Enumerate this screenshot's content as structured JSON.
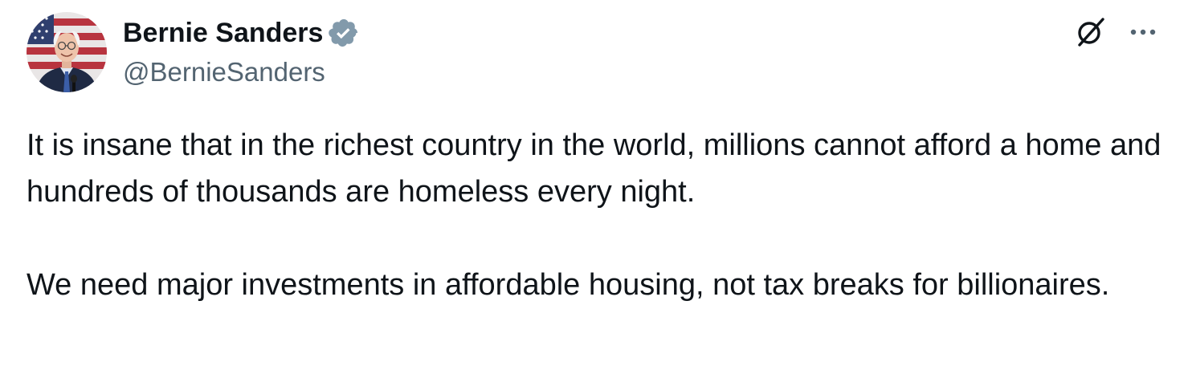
{
  "author": {
    "display_name": "Bernie Sanders",
    "handle": "@BernieSanders",
    "verified": true,
    "avatar_icon": "bernie-sanders-avatar",
    "badge_color": "#829aab"
  },
  "actions": {
    "grok_icon": "grok-icon",
    "more_icon": "more-options-icon"
  },
  "tweet": {
    "paragraphs": [
      "It is insane that in the richest country in the world, millions cannot afford a home and hundreds of thousands are homeless every night.",
      "We need major investments in affordable housing, not tax breaks for billionaires."
    ]
  },
  "colors": {
    "text_primary": "#0f1419",
    "text_secondary": "#536471",
    "background": "#ffffff"
  }
}
